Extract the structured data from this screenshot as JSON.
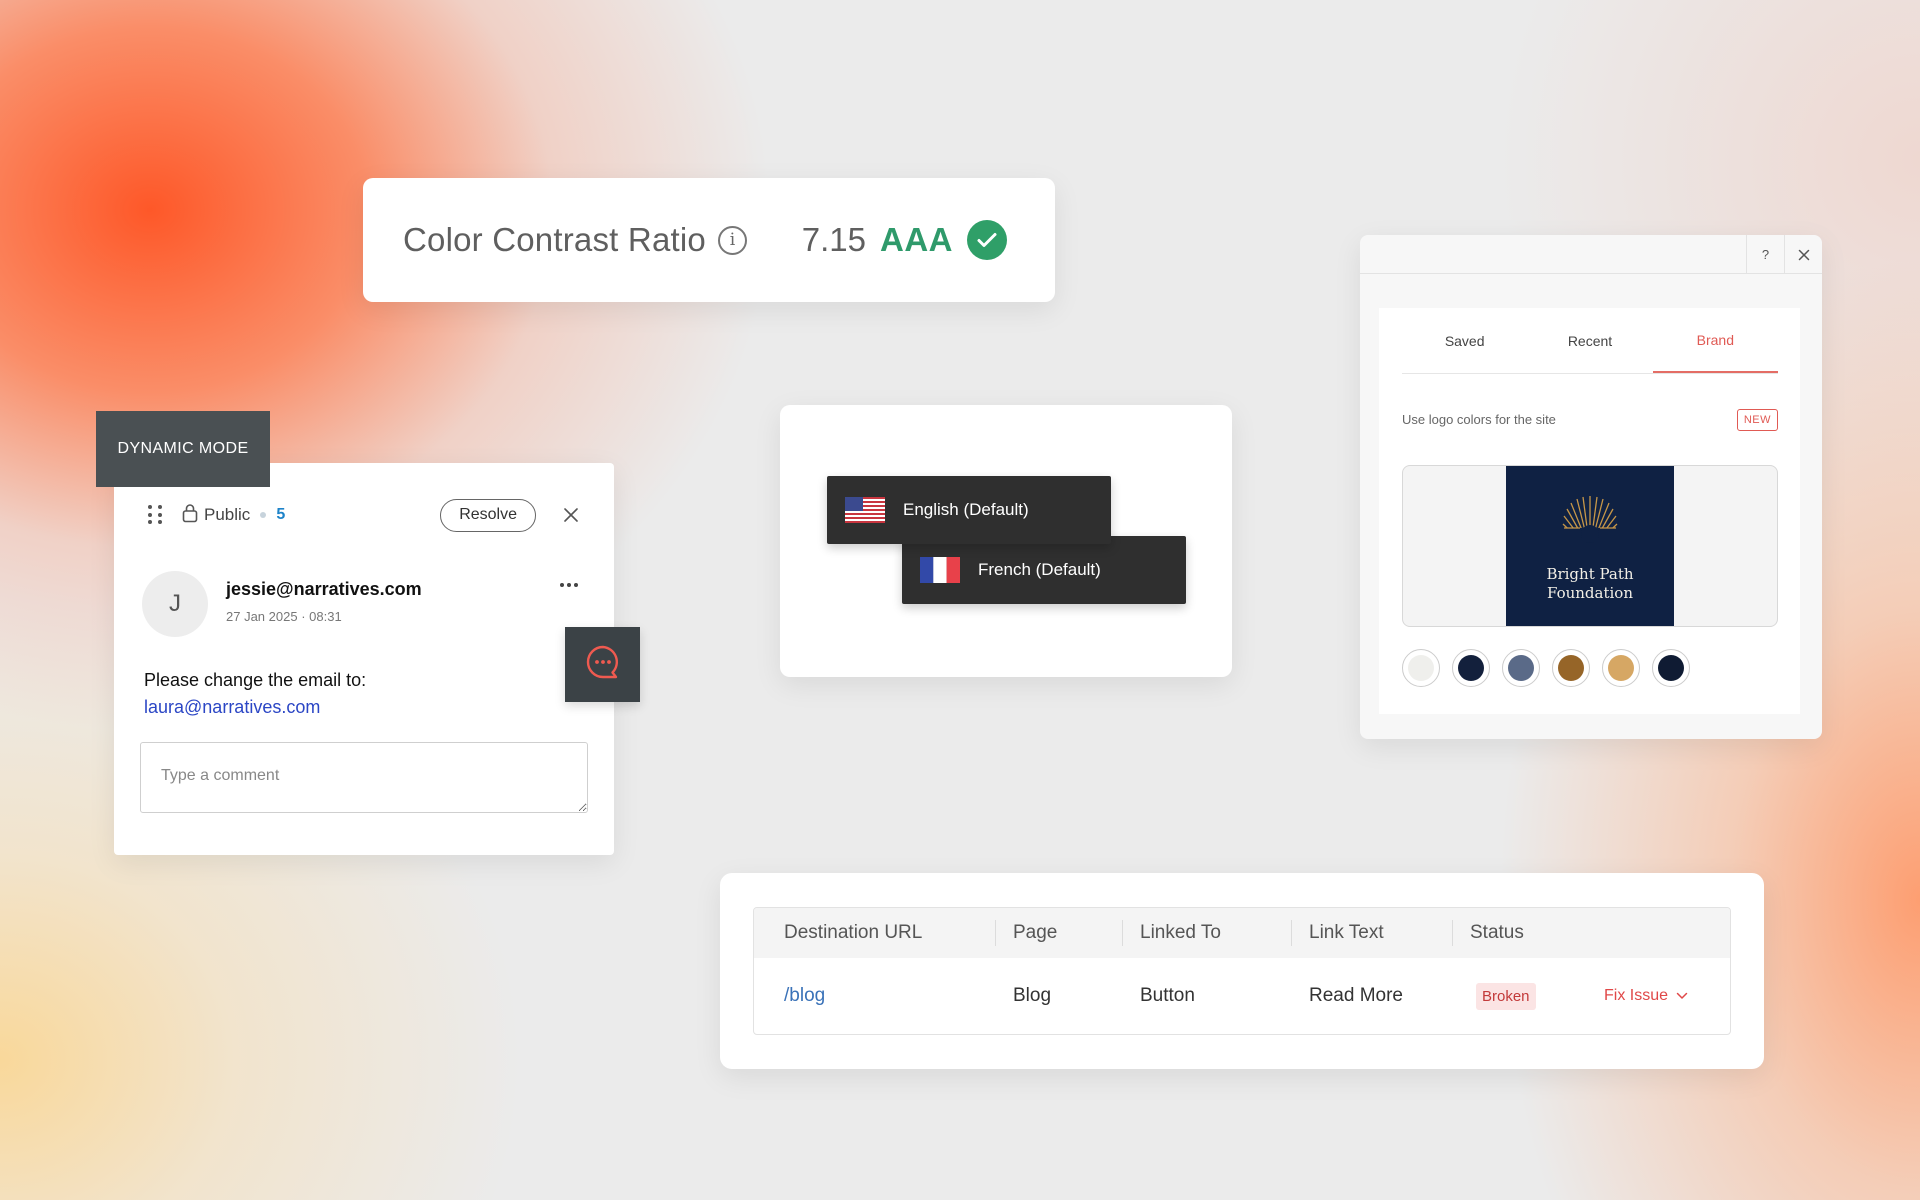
{
  "contrast": {
    "title": "Color Contrast Ratio",
    "info_icon": "i",
    "ratio": "7.15",
    "grade": "AAA",
    "colors": {
      "grade": "#2f9a6b",
      "check": "#2f9f68"
    }
  },
  "comment": {
    "mode_label": "DYNAMIC MODE",
    "visibility": "Public",
    "count": "5",
    "resolve_label": "Resolve",
    "avatar_initial": "J",
    "author_email": "jessie@narratives.com",
    "date": "27 Jan 2025",
    "time": "08:31",
    "message": "Please change the email to:",
    "message_link": "laura@narratives.com",
    "input_placeholder": "Type a comment"
  },
  "languages": {
    "items": [
      {
        "label": "English (Default)",
        "flag": "us-flag-icon"
      },
      {
        "label": "French (Default)",
        "flag": "fr-flag-icon"
      }
    ]
  },
  "brand": {
    "help_label": "?",
    "tabs": [
      {
        "label": "Saved",
        "active": false
      },
      {
        "label": "Recent",
        "active": false
      },
      {
        "label": "Brand",
        "active": true
      }
    ],
    "use_logo_label": "Use logo colors for the site",
    "new_badge": "NEW",
    "logo_line1": "Bright Path",
    "logo_line2": "Foundation",
    "swatches": [
      "#efefec",
      "#13203c",
      "#5a6a88",
      "#966528",
      "#d6a764",
      "#0f1b33"
    ],
    "accent": "#e05a54"
  },
  "links": {
    "columns": [
      "Destination URL",
      "Page",
      "Linked To",
      "Link Text",
      "Status"
    ],
    "rows": [
      {
        "url": "/blog",
        "page": "Blog",
        "linked_to": "Button",
        "link_text": "Read More",
        "status": "Broken",
        "action": "Fix Issue"
      }
    ]
  }
}
